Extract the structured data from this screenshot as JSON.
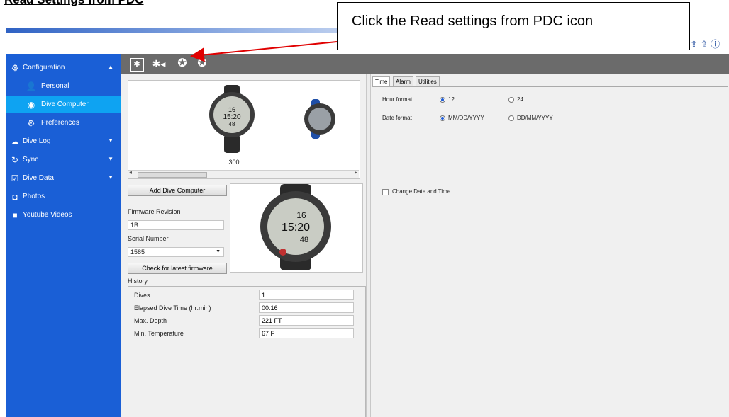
{
  "heading": "Read Settings from PDC",
  "callout": "Click the Read settings from PDC icon",
  "colors": {
    "sidebar": "#1a5fd6",
    "sidebar_selected": "#0ea3f2",
    "toolbar": "#6b6b6b",
    "arrow": "#e00000",
    "radio_on": "#1d5bd6"
  },
  "sidebar": {
    "configuration": "Configuration",
    "personal": "Personal",
    "dive_computer": "Dive Computer",
    "preferences": "Preferences",
    "dive_log": "Dive Log",
    "sync": "Sync",
    "dive_data": "Dive Data",
    "photos": "Photos",
    "youtube_videos": "Youtube Videos"
  },
  "device": {
    "thumb_label": "i300",
    "watch_time": "15:20",
    "watch_top": "16",
    "watch_bottom": "48",
    "add_button": "Add Dive Computer",
    "firmware_label": "Firmware Revision",
    "firmware_value": "1B",
    "serial_label": "Serial Number",
    "serial_value": "1585",
    "check_button": "Check for latest firmware"
  },
  "history": {
    "title": "History",
    "rows": [
      {
        "label": "Dives",
        "value": "1"
      },
      {
        "label": "Elapsed Dive Time (hr:min)",
        "value": "00:16"
      },
      {
        "label": "Max. Depth",
        "value": "221 FT"
      },
      {
        "label": "Min. Temperature",
        "value": "67 F"
      }
    ]
  },
  "settings": {
    "tabs": [
      "Time",
      "Alarm",
      "Utilities"
    ],
    "hour_format": {
      "label": "Hour format",
      "opt1": "12",
      "opt2": "24"
    },
    "date_format": {
      "label": "Date format",
      "opt1": "MM/DD/YYYY",
      "opt2": "DD/MM/YYYY"
    },
    "change_date": "Change Date and Time"
  }
}
